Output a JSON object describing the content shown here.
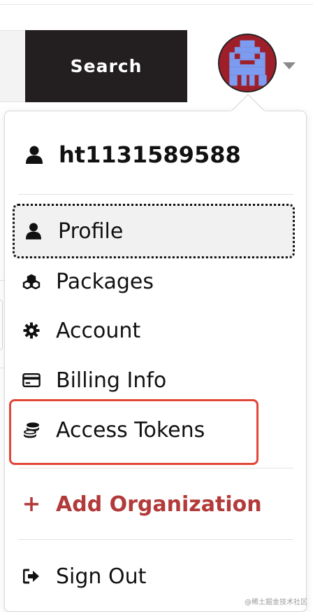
{
  "header": {
    "search_label": "Search"
  },
  "user_menu": {
    "username": "ht1131589588",
    "items": [
      {
        "label": "Profile",
        "icon": "user-icon"
      },
      {
        "label": "Packages",
        "icon": "cubes-icon"
      },
      {
        "label": "Account",
        "icon": "gear-icon"
      },
      {
        "label": "Billing Info",
        "icon": "credit-card-icon"
      },
      {
        "label": "Access Tokens",
        "icon": "coins-icon"
      }
    ],
    "add_org": {
      "label": "Add Organization",
      "icon": "plus-icon"
    },
    "sign_out": {
      "label": "Sign Out",
      "icon": "sign-out-icon"
    }
  },
  "colors": {
    "search_bg": "#231f20",
    "add_org": "#b23a3a",
    "highlight": "#e2463a",
    "avatar_bg": "#9e1f2a",
    "avatar_fg": "#7b9cf0"
  },
  "watermark": "@稀土掘金技术社区"
}
